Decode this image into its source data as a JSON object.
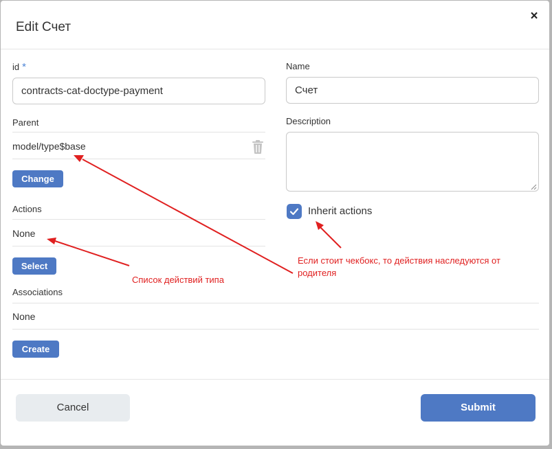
{
  "dialog": {
    "title": "Edit Счет",
    "close_symbol": "×"
  },
  "fields": {
    "id_label": "id",
    "id_required_mark": "*",
    "id_value": "contracts-cat-doctype-payment",
    "name_label": "Name",
    "name_value": "Счет",
    "parent_label": "Parent",
    "parent_value": "model/type$base",
    "change_button": "Change",
    "description_label": "Description",
    "description_value": "",
    "actions_label": "Actions",
    "actions_value": "None",
    "select_button": "Select",
    "inherit_label": "Inherit actions",
    "inherit_checked": true,
    "associations_label": "Associations",
    "associations_value": "None",
    "create_button": "Create"
  },
  "footer": {
    "cancel": "Cancel",
    "submit": "Submit"
  },
  "annotations": {
    "actions_note": "Список действий типа",
    "inherit_note_line1": "Если стоит чекбокс, то действия наследуются от",
    "inherit_note_line2": "родителя"
  },
  "colors": {
    "accent": "#4e79c4",
    "required": "#4f86d6",
    "annotation": "#e02020",
    "cancel_bg": "#e8ecef"
  },
  "icons": {
    "close": "close-icon",
    "trash": "trash-icon",
    "check": "check-icon",
    "resize": "resize-grip-icon"
  }
}
